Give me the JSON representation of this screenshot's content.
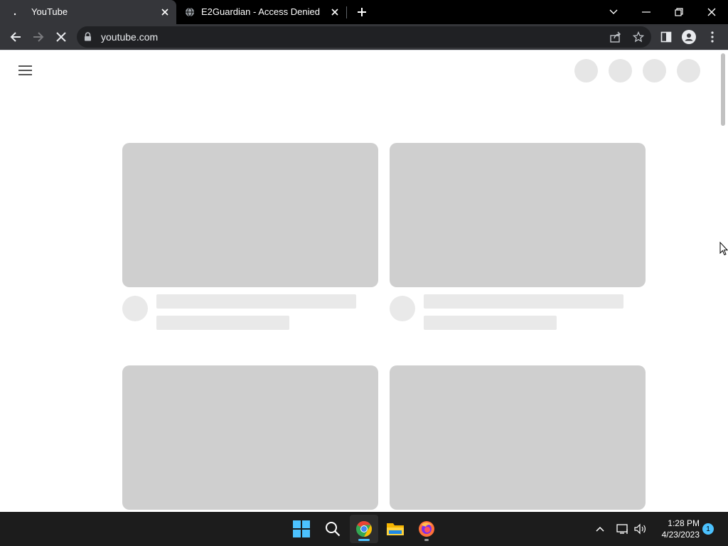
{
  "browser": {
    "tabs": [
      {
        "title": "YouTube",
        "favicon": "loading-dot",
        "active": true
      },
      {
        "title": "E2Guardian - Access Denied",
        "favicon": "globe-icon",
        "active": false
      }
    ],
    "address": "youtube.com"
  },
  "colors": {
    "tab_strip_bg": "#000000",
    "toolbar_bg": "#35363a",
    "omnibox_bg": "#202124",
    "placeholder_thumb": "#cfcfcf",
    "placeholder_light": "#e9e9e9",
    "taskbar_bg": "#1c1c1c",
    "accent": "#4cc2ff"
  },
  "taskbar": {
    "apps": [
      "windows-start",
      "search",
      "chrome",
      "file-explorer",
      "firefox"
    ],
    "time": "1:28 PM",
    "date": "4/23/2023",
    "notification_count": "1"
  }
}
